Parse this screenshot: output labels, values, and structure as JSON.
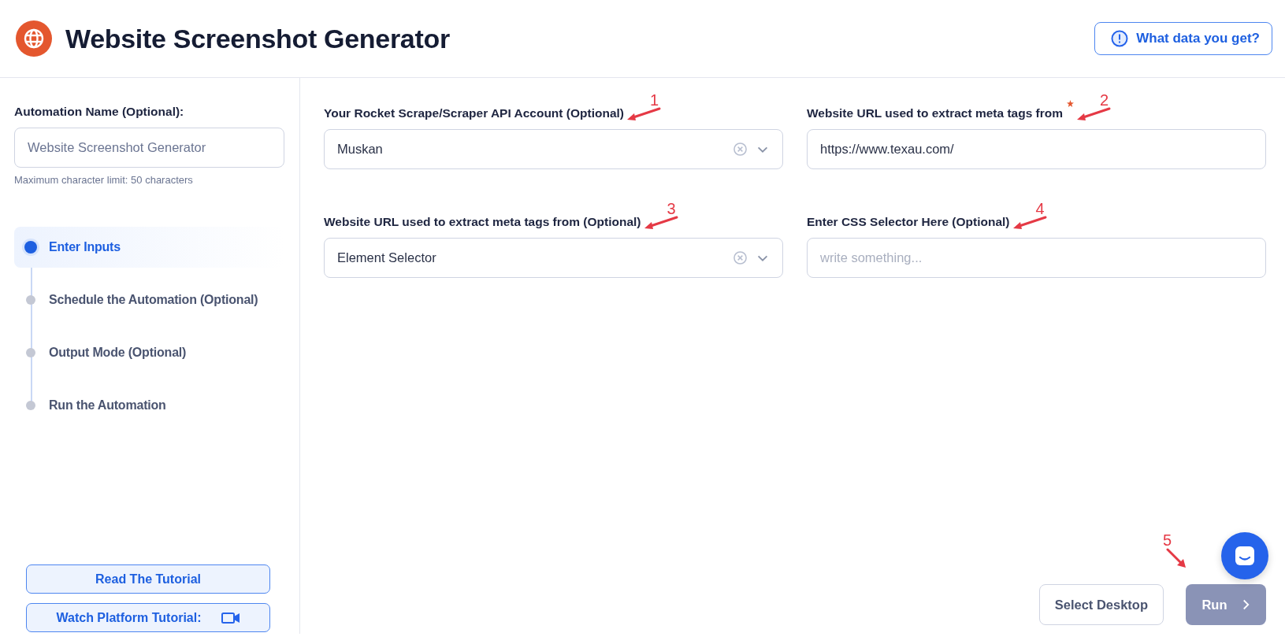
{
  "header": {
    "title": "Website Screenshot Generator",
    "info_button": "What data you get?"
  },
  "sidebar": {
    "name_field": {
      "label": "Automation Name (Optional):",
      "placeholder": "Website Screenshot Generator",
      "hint": "Maximum character limit: 50 characters"
    },
    "steps": [
      {
        "label": "Enter Inputs",
        "selected": true
      },
      {
        "label": "Schedule the Automation (Optional)",
        "selected": false
      },
      {
        "label": "Output Mode (Optional)",
        "selected": false
      },
      {
        "label": "Run the Automation",
        "selected": false
      }
    ],
    "buttons": [
      {
        "label": "Read The Tutorial",
        "kind": "text"
      },
      {
        "label": "Watch Platform Tutorial:",
        "kind": "video"
      }
    ]
  },
  "fields": [
    {
      "kind": "select",
      "label": "Your Rocket Scrape/Scraper API Account (Optional)",
      "required": false,
      "value": "Muskan",
      "annotation": "1"
    },
    {
      "kind": "text",
      "label": "Website URL used to extract meta tags from",
      "required": true,
      "value": "https://www.texau.com/",
      "annotation": "2"
    },
    {
      "kind": "select",
      "label": "Website URL used to extract meta tags from (Optional)",
      "required": false,
      "value": "Element Selector",
      "annotation": "3"
    },
    {
      "kind": "text",
      "label": "Enter CSS Selector Here (Optional)",
      "required": false,
      "placeholder": "write something...",
      "annotation": "4"
    }
  ],
  "footer": {
    "secondary_button": "Select Desktop",
    "run_button": {
      "label": "Run",
      "disabled": true,
      "annotation": "5"
    }
  }
}
